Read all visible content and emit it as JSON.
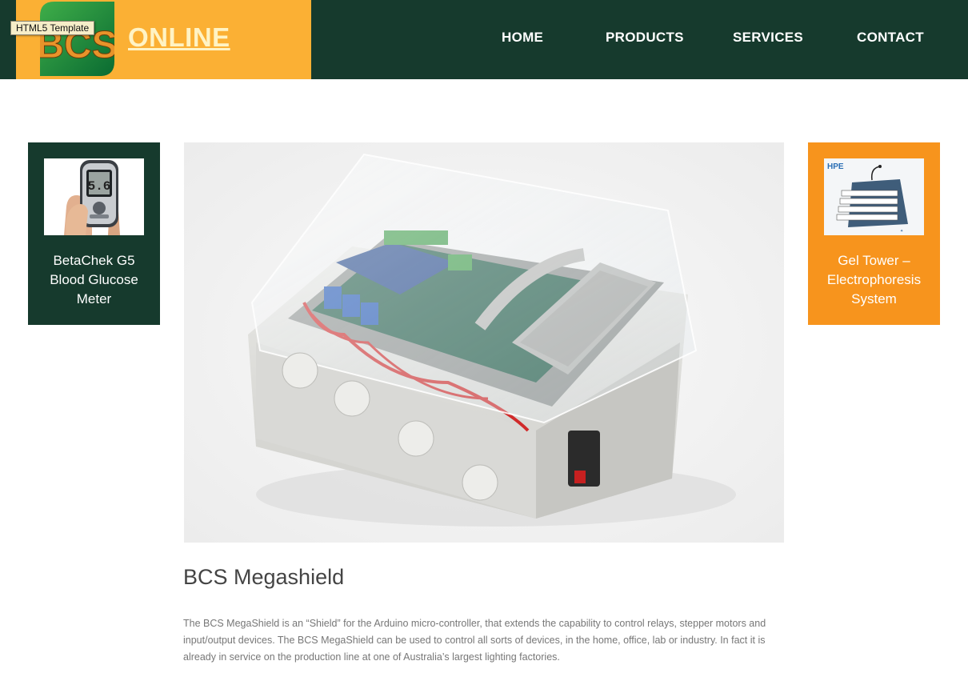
{
  "brand": {
    "logo_text": "BCS",
    "online_label": "ONLINE",
    "tooltip": "HTML5 Template"
  },
  "nav": {
    "home": "HOME",
    "products": "PRODUCTS",
    "services": "SERVICES",
    "contact": "CONTACT"
  },
  "colors": {
    "header_bg": "#163a2d",
    "brand_bg": "#fbb034",
    "card_left_bg": "#163a2d",
    "card_right_bg": "#f7941d"
  },
  "sidebar_left": {
    "label": "BetaChek G5 Blood Glucose Meter",
    "image": "glucose-meter-photo"
  },
  "sidebar_right": {
    "label": "Gel Tower – Electrophoresis System",
    "image": "gel-tower-photo",
    "image_brand": "HPE"
  },
  "main": {
    "image": "megashield-enclosure-photo",
    "title": "BCS Megashield",
    "description": "The BCS MegaShield is an “Shield” for the Arduino micro-controller, that extends the capability to control relays, stepper motors and input/output devices. The BCS MegaShield can be used to control all sorts of devices, in the home, office, lab or industry. In fact it is already in service on the production line at one of Australia’s largest lighting factories."
  }
}
